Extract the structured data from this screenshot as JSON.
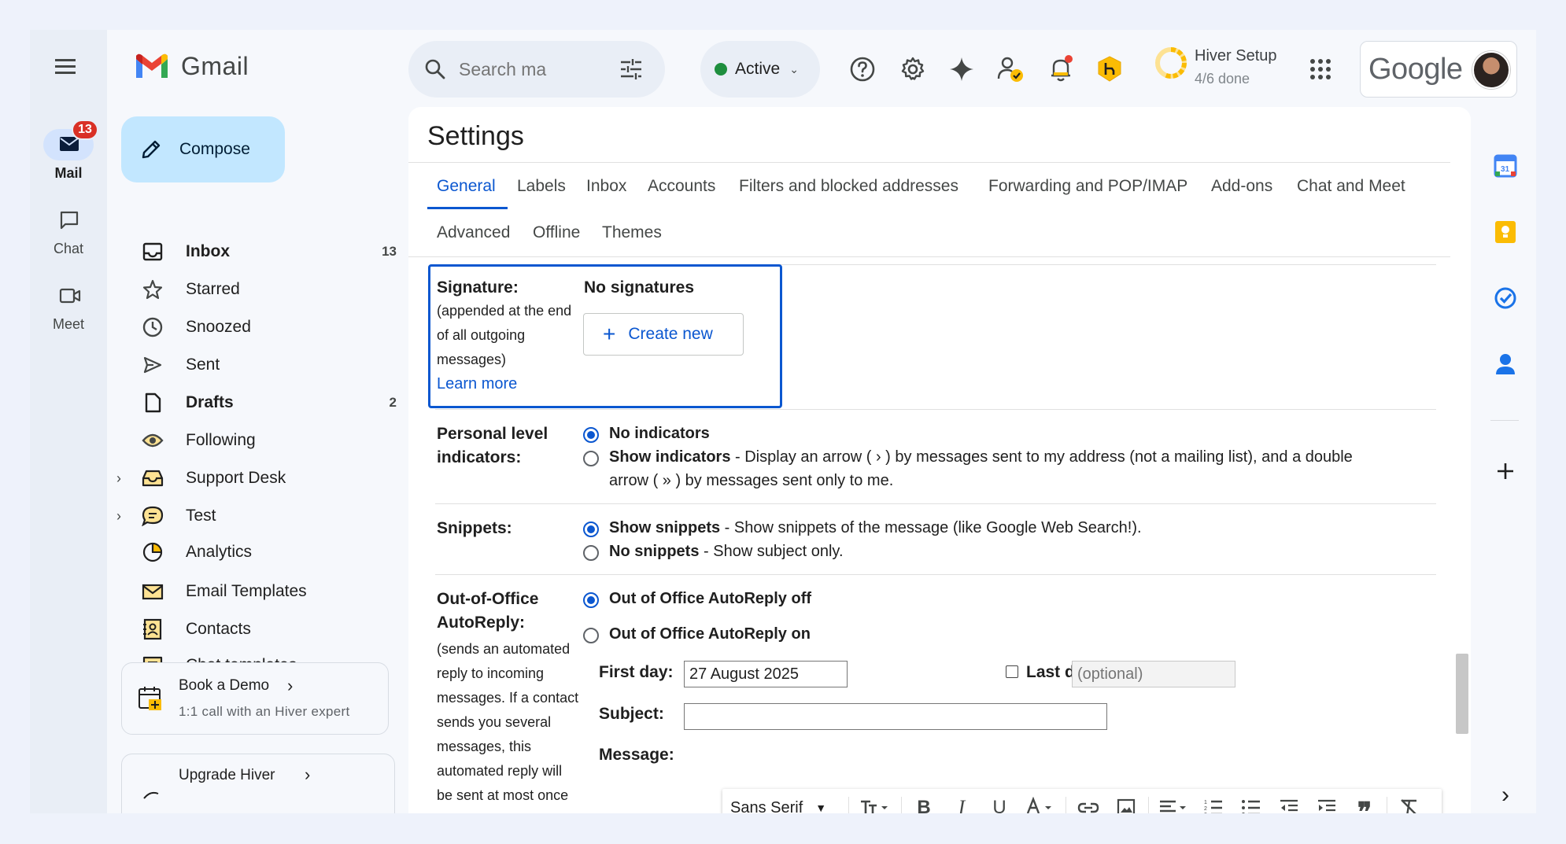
{
  "rail": {
    "mail_label": "Mail",
    "mail_badge": "13",
    "chat_label": "Chat",
    "meet_label": "Meet"
  },
  "app": {
    "name": "Gmail"
  },
  "compose_label": "Compose",
  "nav": [
    {
      "label": "Inbox",
      "count": "13",
      "icon": "inbox-icon",
      "bold": true
    },
    {
      "label": "Starred",
      "count": "",
      "icon": "star-icon",
      "bold": false
    },
    {
      "label": "Snoozed",
      "count": "",
      "icon": "clock-icon",
      "bold": false
    },
    {
      "label": "Sent",
      "count": "",
      "icon": "send-icon",
      "bold": false
    },
    {
      "label": "Drafts",
      "count": "2",
      "icon": "file-icon",
      "bold": true
    },
    {
      "label": "Following",
      "count": "",
      "icon": "eye-icon",
      "bold": false
    },
    {
      "label": "Support Desk",
      "count": "",
      "icon": "support-inbox-icon",
      "bold": false
    },
    {
      "label": "Test",
      "count": "",
      "icon": "chat-bubble-icon",
      "bold": false
    },
    {
      "label": "Analytics",
      "count": "",
      "icon": "pie-chart-icon",
      "bold": false
    },
    {
      "label": "Email Templates",
      "count": "",
      "icon": "email-template-icon",
      "bold": false
    },
    {
      "label": "Contacts",
      "count": "",
      "icon": "contacts-icon",
      "bold": false
    },
    {
      "label": "Chat templates",
      "count": "",
      "icon": "chat-template-icon",
      "bold": false
    }
  ],
  "demo_card": {
    "title": "Book a Demo",
    "subtitle": "1:1 call with an Hiver expert"
  },
  "upgrade_card": {
    "title": "Upgrade Hiver"
  },
  "search": {
    "placeholder": "Search ma"
  },
  "status": {
    "label": "Active",
    "color": "#1e8e3e"
  },
  "hiver_setup": {
    "title": "Hiver Setup",
    "progress": "4/6 done"
  },
  "google": {
    "wordmark": "Google"
  },
  "settings": {
    "title": "Settings",
    "tabs_row1": [
      "General",
      "Labels",
      "Inbox",
      "Accounts",
      "Filters and blocked addresses",
      "Forwarding and POP/IMAP",
      "Add-ons",
      "Chat and Meet"
    ],
    "tabs_row2": [
      "Advanced",
      "Offline",
      "Themes"
    ],
    "active_tab": "General",
    "signature": {
      "label": "Signature:",
      "desc_lines": [
        "(appended at the end",
        "of all outgoing",
        "messages)"
      ],
      "learn_more": "Learn more",
      "status": "No signatures",
      "create_new": "Create new"
    },
    "indicators": {
      "label_lines": [
        "Personal level",
        "indicators:"
      ],
      "opt1": "No indicators",
      "opt2_bold": "Show indicators",
      "opt2_line1": " - Display an arrow ( › ) by messages sent to my address (not a mailing list), and a double",
      "opt2_line2": "arrow ( » ) by messages sent only to me."
    },
    "snippets": {
      "label": "Snippets:",
      "opt1_bold": "Show snippets",
      "opt1_rest": " - Show snippets of the message (like Google Web Search!).",
      "opt2_bold": "No snippets",
      "opt2_rest": " - Show subject only."
    },
    "ooo": {
      "label_lines": [
        "Out-of-Office",
        "AutoReply:"
      ],
      "desc_lines": [
        "(sends an automated",
        "reply to incoming",
        "messages. If a contact",
        "sends you several",
        "messages, this",
        "automated reply will",
        "be sent at most once"
      ],
      "opt_off": "Out of Office AutoReply off",
      "opt_on": "Out of Office AutoReply on",
      "first_day_label": "First day:",
      "first_day_value": "27 August 2025",
      "last_day_label": "Last day:",
      "last_day_placeholder": "(optional)",
      "subject_label": "Subject:",
      "message_label": "Message:"
    },
    "toolbar": {
      "font": "Sans Serif"
    }
  }
}
